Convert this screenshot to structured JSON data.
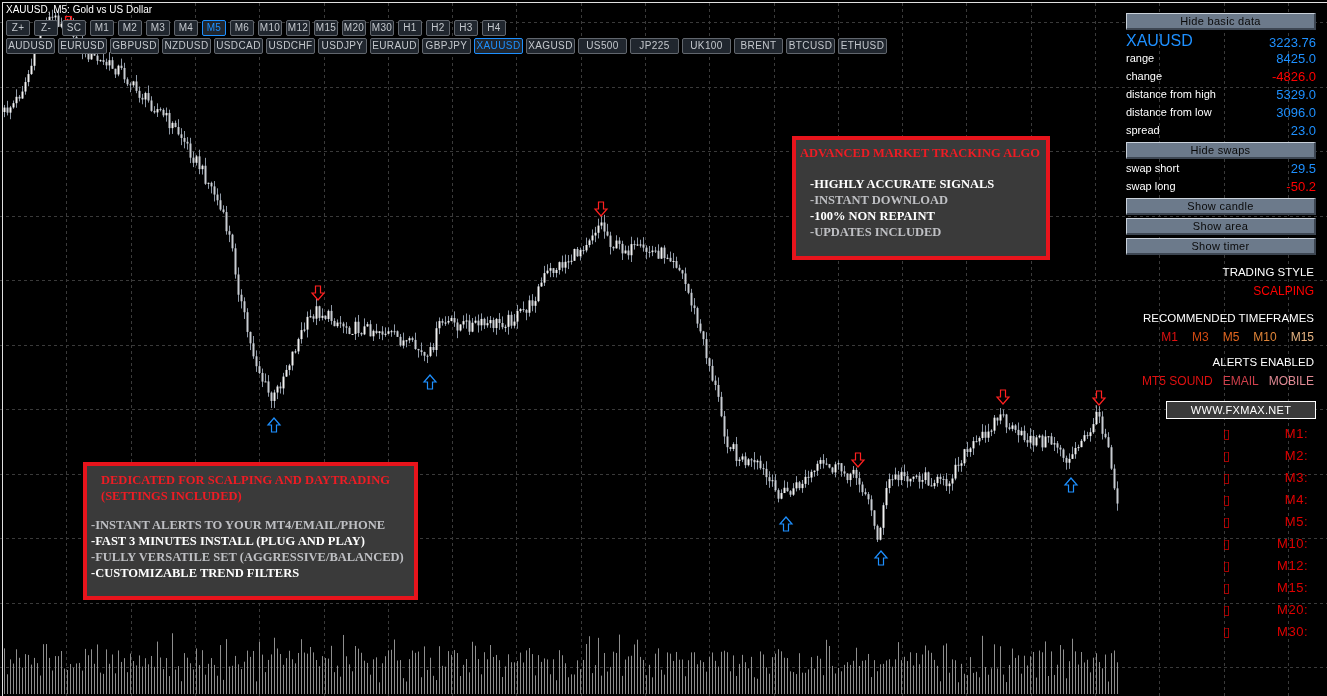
{
  "chart": {
    "title": "XAUUSD, M5: Gold vs US Dollar"
  },
  "timeframe_buttons": [
    {
      "label": "Z+",
      "selected": false
    },
    {
      "label": "Z-",
      "selected": false
    },
    {
      "label": "SC",
      "selected": false
    },
    {
      "label": "M1",
      "selected": false
    },
    {
      "label": "M2",
      "selected": false
    },
    {
      "label": "M3",
      "selected": false
    },
    {
      "label": "M4",
      "selected": false
    },
    {
      "label": "M5",
      "selected": true
    },
    {
      "label": "M6",
      "selected": false
    },
    {
      "label": "M10",
      "selected": false
    },
    {
      "label": "M12",
      "selected": false
    },
    {
      "label": "M15",
      "selected": false
    },
    {
      "label": "M20",
      "selected": false
    },
    {
      "label": "M30",
      "selected": false
    },
    {
      "label": "H1",
      "selected": false
    },
    {
      "label": "H2",
      "selected": false
    },
    {
      "label": "H3",
      "selected": false
    },
    {
      "label": "H4",
      "selected": false
    }
  ],
  "symbol_buttons": [
    {
      "label": "AUDUSD",
      "selected": false
    },
    {
      "label": "EURUSD",
      "selected": false
    },
    {
      "label": "GBPUSD",
      "selected": false
    },
    {
      "label": "NZDUSD",
      "selected": false
    },
    {
      "label": "USDCAD",
      "selected": false
    },
    {
      "label": "USDCHF",
      "selected": false
    },
    {
      "label": "USDJPY",
      "selected": false
    },
    {
      "label": "EURAUD",
      "selected": false
    },
    {
      "label": "GBPJPY",
      "selected": false
    },
    {
      "label": "XAUUSD",
      "selected": true
    },
    {
      "label": "XAGUSD",
      "selected": false
    },
    {
      "label": "US500",
      "selected": false
    },
    {
      "label": "JP225",
      "selected": false
    },
    {
      "label": "UK100",
      "selected": false
    },
    {
      "label": "BRENT",
      "selected": false
    },
    {
      "label": "BTCUSD",
      "selected": false
    },
    {
      "label": "ETHUSD",
      "selected": false
    }
  ],
  "promo_top": {
    "heading": "ADVANCED MARKET TRACKING ALGO",
    "lines": [
      {
        "text": "-HIGHLY ACCURATE SIGNALS",
        "color": "#ffffff"
      },
      {
        "text": "-INSTANT DOWNLOAD",
        "color": "#bfc0c4"
      },
      {
        "text": "-100% NON REPAINT",
        "color": "#ffffff"
      },
      {
        "text": "-UPDATES INCLUDED",
        "color": "#bfc0c4"
      }
    ]
  },
  "promo_bottom": {
    "heading_lines": [
      "DEDICATED FOR SCALPING AND DAYTRADING",
      "(SETTINGS INCLUDED)"
    ],
    "lines": [
      {
        "text": "-INSTANT ALERTS TO YOUR MT4/EMAIL/PHONE",
        "color": "#bfc0c4"
      },
      {
        "text": "-FAST 3 MINUTES INSTALL (PLUG AND PLAY)",
        "color": "#ffffff"
      },
      {
        "text": "-FULLY VERSATILE SET (AGGRESSIVE/BALANCED)",
        "color": "#bfc0c4"
      },
      {
        "text": "-CUSTOMIZABLE TREND FILTERS",
        "color": "#ffffff"
      }
    ]
  },
  "info_panel": {
    "basic_data_button": "Hide basic data",
    "symbol": "XAUUSD",
    "price": "3223.76",
    "stats": [
      {
        "label": "range",
        "value": "8425.0",
        "color": "#1e90ff"
      },
      {
        "label": "change",
        "value": "-4826.0",
        "color": "#ff0000"
      },
      {
        "label": "distance from high",
        "value": "5329.0",
        "color": "#1e90ff"
      },
      {
        "label": "distance from low",
        "value": "3096.0",
        "color": "#1e90ff"
      },
      {
        "label": "spread",
        "value": "23.0",
        "color": "#1e90ff"
      }
    ],
    "swaps_button": "Hide swaps",
    "swaps": [
      {
        "label": "swap short",
        "value": "29.5",
        "color": "#1e90ff"
      },
      {
        "label": "swap long",
        "value": "-50.2",
        "color": "#ff0000"
      }
    ],
    "toggle_buttons": [
      "Show candle",
      "Show area",
      "Show timer"
    ],
    "trading_style": {
      "heading": "TRADING STYLE",
      "value": "SCALPING"
    },
    "timeframes": {
      "heading": "RECOMMENDED TIMEFRAMES",
      "items": [
        {
          "label": "M1",
          "color": "#e01010"
        },
        {
          "label": "M3",
          "color": "#d24a12"
        },
        {
          "label": "M5",
          "color": "#e0641e"
        },
        {
          "label": "M10",
          "color": "#e08438"
        },
        {
          "label": "M15",
          "color": "#e6b482"
        }
      ]
    },
    "alerts": {
      "heading": "ALERTS ENABLED",
      "items": [
        {
          "label": "MT5 SOUND",
          "color": "#e01010"
        },
        {
          "label": "EMAIL",
          "color": "#d0404c"
        },
        {
          "label": "MOBILE",
          "color": "#e08a94"
        }
      ]
    },
    "website": "WWW.FXMAX.NET",
    "timers": [
      {
        "label": "M1:",
        "value": "▯"
      },
      {
        "label": "M2:",
        "value": "▯"
      },
      {
        "label": "M3:",
        "value": "▯"
      },
      {
        "label": "M4:",
        "value": "▯"
      },
      {
        "label": "M5:",
        "value": "▯"
      },
      {
        "label": "M10:",
        "value": "▯"
      },
      {
        "label": "M12:",
        "value": "▯"
      },
      {
        "label": "M15:",
        "value": "▯"
      },
      {
        "label": "M20:",
        "value": "▯"
      },
      {
        "label": "M30:",
        "value": "▯"
      }
    ]
  }
}
